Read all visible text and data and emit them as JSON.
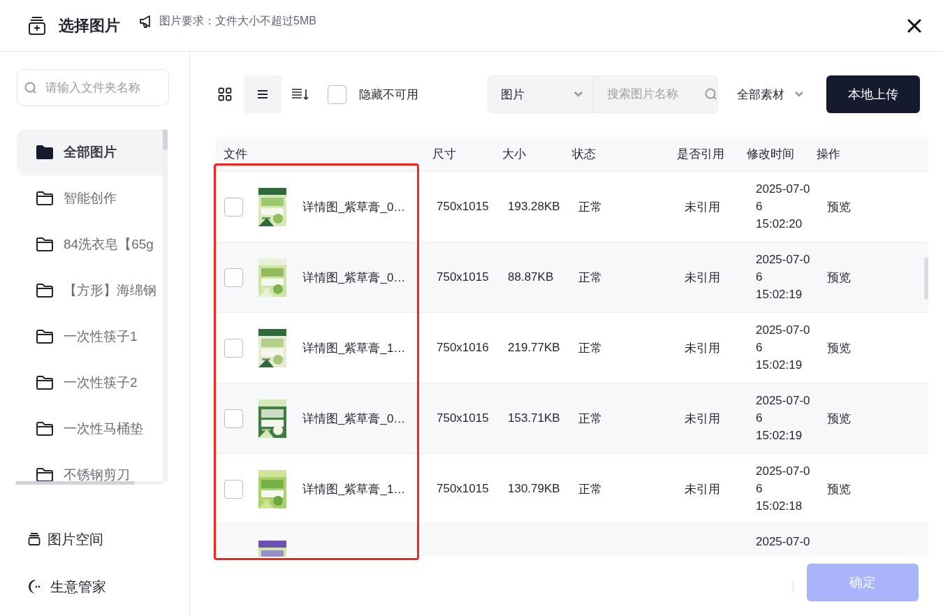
{
  "dialog": {
    "title": "选择图片",
    "notice": "图片要求：文件大小不超过5MB"
  },
  "sidebar": {
    "search": {
      "placeholder": "请输入文件夹名称"
    },
    "folders": [
      {
        "label": "全部图片",
        "selected": true
      },
      {
        "label": "智能创作",
        "selected": false
      },
      {
        "label": "84洗衣皂【65g",
        "selected": false
      },
      {
        "label": "【方形】海绵钢",
        "selected": false
      },
      {
        "label": "一次性筷子1",
        "selected": false
      },
      {
        "label": "一次性筷子2",
        "selected": false
      },
      {
        "label": "一次性马桶垫",
        "selected": false
      },
      {
        "label": "不锈钢剪刀",
        "selected": false
      }
    ],
    "links": [
      {
        "label": "图片空间",
        "kind": "space"
      },
      {
        "label": "生意管家",
        "kind": "manager"
      }
    ]
  },
  "toolbar": {
    "views": [
      {
        "kind": "grid",
        "selected": false
      },
      {
        "kind": "list",
        "selected": true
      },
      {
        "kind": "sort",
        "selected": false
      }
    ],
    "hide_unavailable": {
      "label": "隐藏不可用",
      "checked": false
    },
    "type_select": {
      "value": "图片"
    },
    "search": {
      "placeholder": "搜索图片名称"
    },
    "material_select": {
      "value": "全部素材"
    },
    "upload_button": "本地上传"
  },
  "table": {
    "columns": [
      "文件",
      "尺寸",
      "大小",
      "状态",
      "是否引用",
      "修改时间",
      "操作"
    ],
    "rows": [
      {
        "checked": false,
        "name": "详情图_紫草膏_0…",
        "size": "750x1015",
        "bytes": "193.28KB",
        "status": "正常",
        "reference": "未引用",
        "modified": "2025-07-06 15:02:20",
        "action": "预览"
      },
      {
        "checked": false,
        "name": "详情图_紫草膏_0…",
        "size": "750x1015",
        "bytes": "88.87KB",
        "status": "正常",
        "reference": "未引用",
        "modified": "2025-07-06 15:02:19",
        "action": "预览"
      },
      {
        "checked": false,
        "name": "详情图_紫草膏_1…",
        "size": "750x1016",
        "bytes": "219.77KB",
        "status": "正常",
        "reference": "未引用",
        "modified": "2025-07-06 15:02:19",
        "action": "预览"
      },
      {
        "checked": false,
        "name": "详情图_紫草膏_0…",
        "size": "750x1015",
        "bytes": "153.71KB",
        "status": "正常",
        "reference": "未引用",
        "modified": "2025-07-06 15:02:19",
        "action": "预览"
      },
      {
        "checked": false,
        "name": "详情图_紫草膏_1…",
        "size": "750x1015",
        "bytes": "130.79KB",
        "status": "正常",
        "reference": "未引用",
        "modified": "2025-07-06 15:02:18",
        "action": "预览"
      },
      {
        "modified": "2025-07-0"
      }
    ]
  },
  "footer": {
    "confirm_button": {
      "label": "确定",
      "disabled": true
    }
  }
}
